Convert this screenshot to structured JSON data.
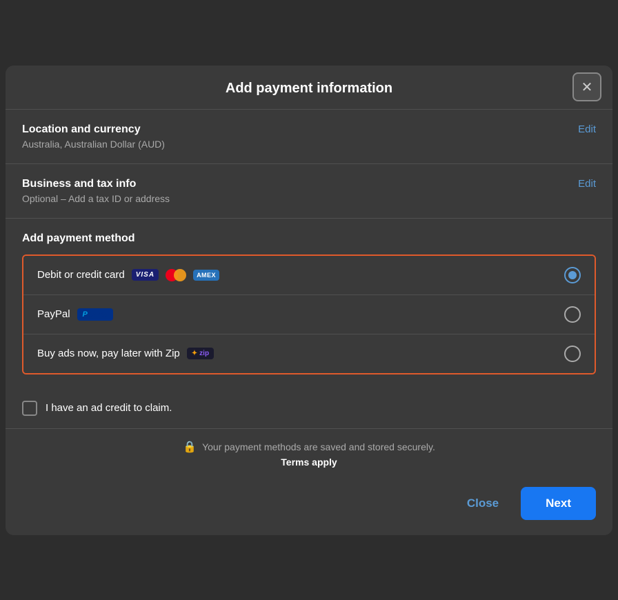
{
  "modal": {
    "title": "Add payment information",
    "close_label": "✕"
  },
  "location_section": {
    "title": "Location and currency",
    "subtitle": "Australia, Australian Dollar (AUD)",
    "edit_label": "Edit"
  },
  "business_section": {
    "title": "Business and tax info",
    "subtitle": "Optional – Add a tax ID or address",
    "edit_label": "Edit"
  },
  "payment_method": {
    "title": "Add payment method",
    "options": [
      {
        "id": "card",
        "label": "Debit or credit card",
        "selected": true
      },
      {
        "id": "paypal",
        "label": "PayPal",
        "selected": false
      },
      {
        "id": "zip",
        "label": "Buy ads now, pay later with Zip",
        "selected": false
      }
    ]
  },
  "ad_credit": {
    "label": "I have an ad credit to claim.",
    "checked": false
  },
  "security": {
    "message": "Your payment methods are saved and stored securely.",
    "terms_label": "Terms apply"
  },
  "footer": {
    "close_label": "Close",
    "next_label": "Next"
  }
}
